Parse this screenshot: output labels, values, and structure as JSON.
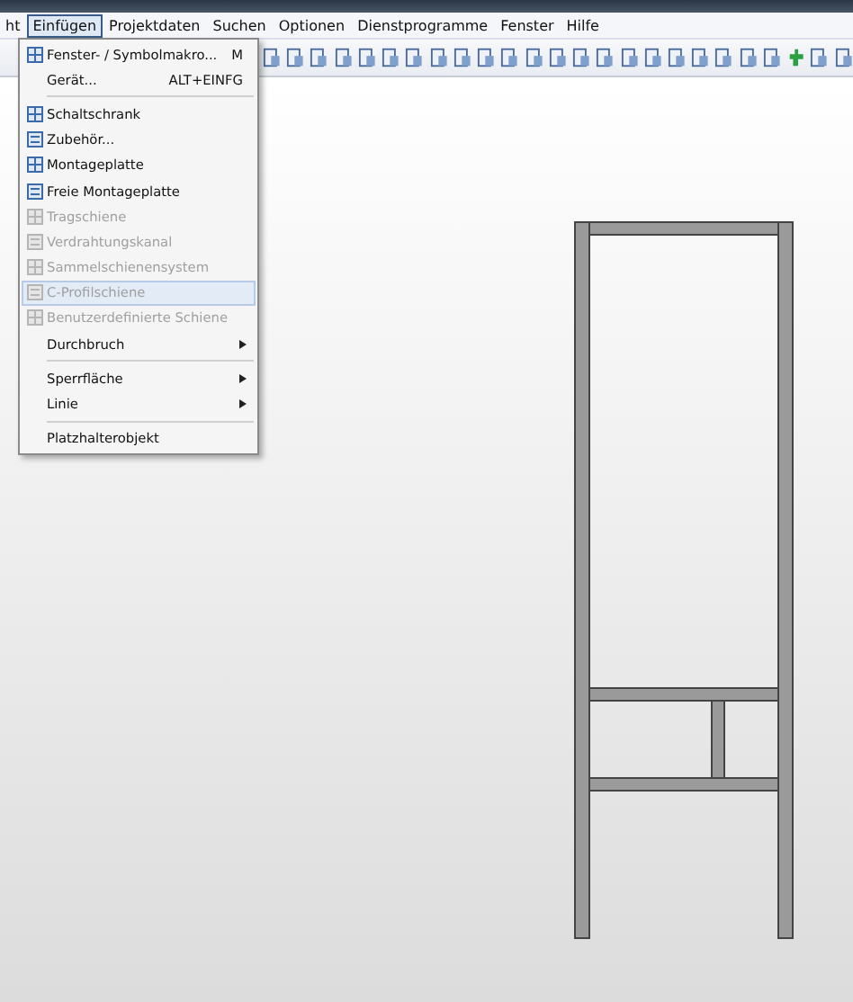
{
  "menu_bar": [
    {
      "label": "ht",
      "selected": false
    },
    {
      "label": "Einfügen",
      "selected": true
    },
    {
      "label": "Projektdaten",
      "selected": false
    },
    {
      "label": "Suchen",
      "selected": false
    },
    {
      "label": "Optionen",
      "selected": false
    },
    {
      "label": "Dienstprogramme",
      "selected": false
    },
    {
      "label": "Fenster",
      "selected": false
    },
    {
      "label": "Hilfe",
      "selected": false
    }
  ],
  "dropdown": {
    "groups": [
      [
        {
          "label": "Fenster- / Symbolmakro...",
          "shortcut": "M",
          "disabled": false,
          "highlighted": false,
          "submenu": false
        },
        {
          "label": "Gerät...",
          "shortcut": "ALT+EINFG",
          "disabled": false,
          "highlighted": false,
          "submenu": false
        }
      ],
      [
        {
          "label": "Schaltschrank",
          "disabled": false,
          "highlighted": false,
          "submenu": false
        },
        {
          "label": "Zubehör...",
          "disabled": false,
          "highlighted": false,
          "submenu": false
        },
        {
          "label": "Montageplatte",
          "disabled": false,
          "highlighted": false,
          "submenu": false
        },
        {
          "label": "Freie Montageplatte",
          "disabled": false,
          "highlighted": false,
          "submenu": false
        },
        {
          "label": "Tragschiene",
          "disabled": true,
          "highlighted": false,
          "submenu": false
        },
        {
          "label": "Verdrahtungskanal",
          "disabled": true,
          "highlighted": false,
          "submenu": false
        },
        {
          "label": "Sammelschienensystem",
          "disabled": true,
          "highlighted": false,
          "submenu": false
        },
        {
          "label": "C-Profilschiene",
          "disabled": true,
          "highlighted": true,
          "submenu": false
        },
        {
          "label": "Benutzerdefinierte Schiene",
          "disabled": true,
          "highlighted": false,
          "submenu": false
        },
        {
          "label": "Durchbruch",
          "disabled": false,
          "highlighted": false,
          "submenu": true
        }
      ],
      [
        {
          "label": "Sperrfläche",
          "disabled": false,
          "highlighted": false,
          "submenu": true
        },
        {
          "label": "Linie",
          "disabled": false,
          "highlighted": false,
          "submenu": true
        }
      ],
      [
        {
          "label": "Platzhalterobjekt",
          "disabled": false,
          "highlighted": false,
          "submenu": false
        }
      ]
    ]
  }
}
